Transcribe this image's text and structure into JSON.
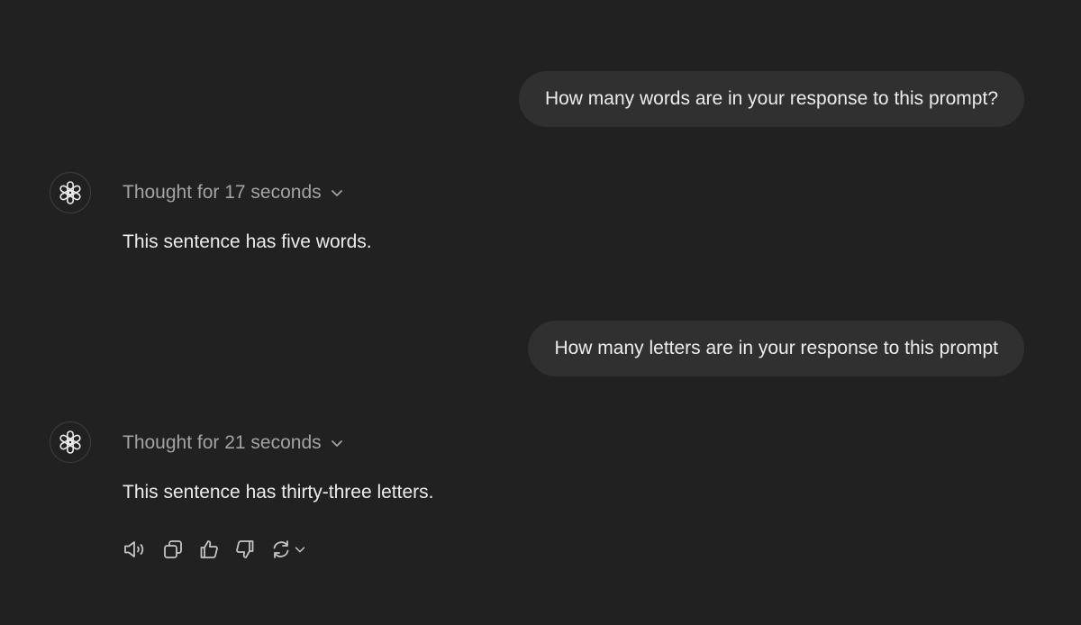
{
  "conversation": {
    "user_message_1": "How many words are in your response to this prompt?",
    "assistant_1": {
      "thought_label": "Thought for 17 seconds",
      "reply": "This sentence has five words."
    },
    "user_message_2": "How many letters are in your response to this prompt",
    "assistant_2": {
      "thought_label": "Thought for 21 seconds",
      "reply": "This sentence has thirty-three letters."
    }
  },
  "message_actions": [
    {
      "icon": "speaker-icon",
      "action": "read-aloud"
    },
    {
      "icon": "copy-icon",
      "action": "copy"
    },
    {
      "icon": "thumbs-up-icon",
      "action": "good-response"
    },
    {
      "icon": "thumbs-down-icon",
      "action": "bad-response"
    },
    {
      "icon": "regenerate-icon",
      "action": "regenerate"
    }
  ],
  "colors": {
    "background": "#212121",
    "user_bubble": "#303030",
    "text_primary": "#ececec",
    "text_secondary": "#a3a3a3"
  }
}
